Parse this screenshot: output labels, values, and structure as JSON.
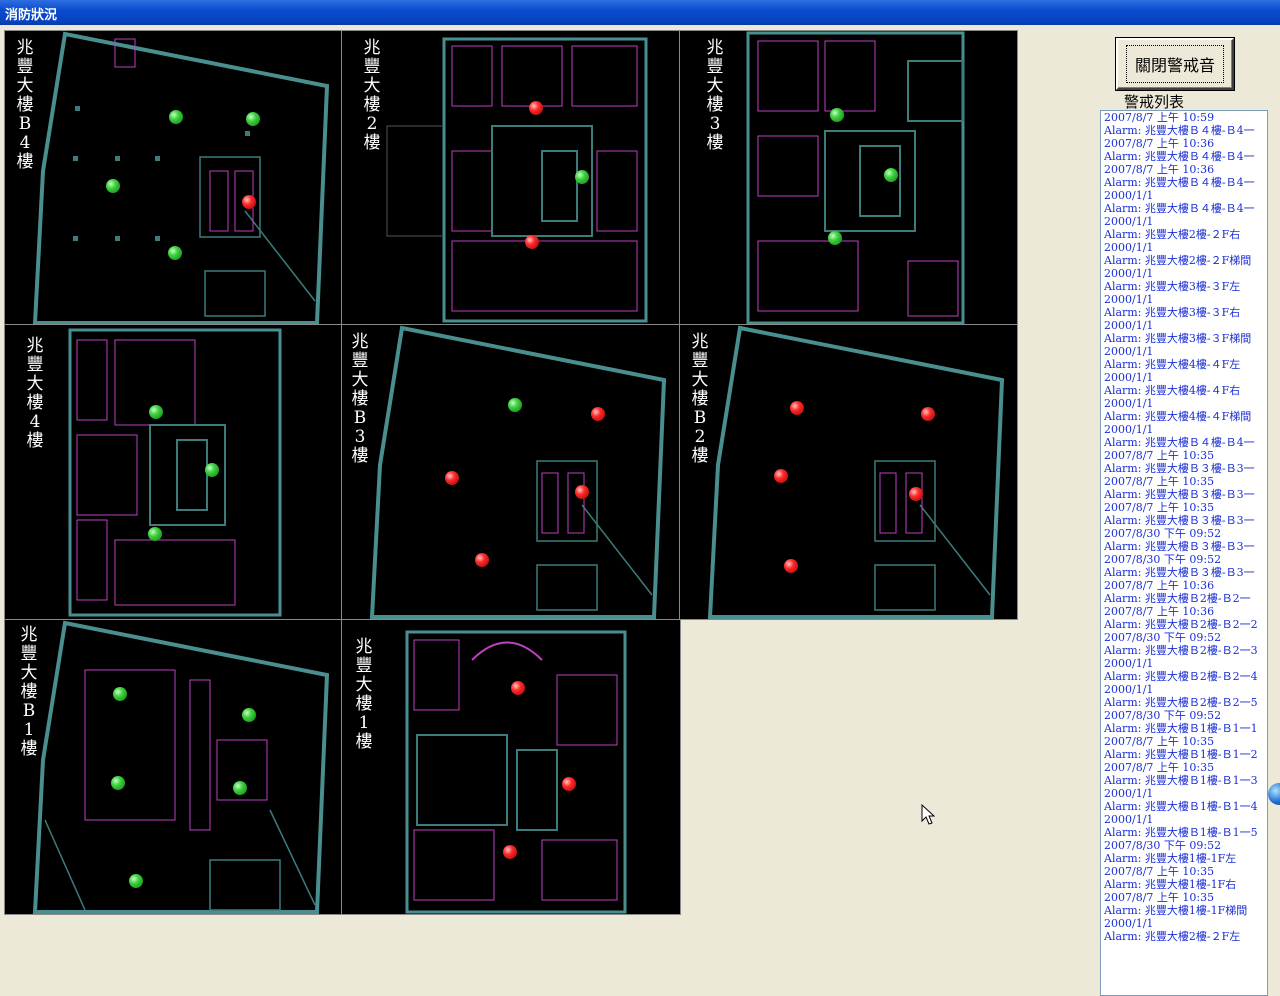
{
  "window": {
    "title": "消防狀況"
  },
  "panels": [
    {
      "label": "兆豐大樓B4樓",
      "dots": [
        "green",
        "green",
        "green",
        "red",
        "green"
      ]
    },
    {
      "label": "兆豐大樓2樓",
      "dots": [
        "red",
        "green",
        "red"
      ]
    },
    {
      "label": "兆豐大樓3樓",
      "dots": [
        "green",
        "green",
        "green"
      ]
    },
    {
      "label": "兆豐大樓4樓",
      "dots": [
        "green",
        "green",
        "green"
      ]
    },
    {
      "label": "兆豐大樓B3樓",
      "dots": [
        "green",
        "red",
        "red",
        "red",
        "red"
      ]
    },
    {
      "label": "兆豐大樓B2樓",
      "dots": [
        "red",
        "red",
        "red",
        "red",
        "red"
      ]
    },
    {
      "label": "兆豐大樓B1樓",
      "dots": [
        "green",
        "green",
        "green",
        "green",
        "green"
      ]
    },
    {
      "label": "兆豐大樓1樓",
      "dots": [
        "red",
        "red",
        "red"
      ]
    }
  ],
  "toolbar": {
    "silence_button": "關閉警戒音"
  },
  "alarm_list": {
    "title": "警戒列表",
    "items": [
      "2007/8/7 上午 10:59",
      "Alarm: 兆豐大樓Ｂ４樓-Ｂ4一",
      "2007/8/7 上午 10:36",
      "Alarm: 兆豐大樓Ｂ４樓-Ｂ4一",
      "2007/8/7 上午 10:36",
      "Alarm: 兆豐大樓Ｂ４樓-Ｂ4一",
      "2000/1/1",
      "Alarm: 兆豐大樓Ｂ４樓-Ｂ4一",
      "2000/1/1",
      "Alarm: 兆豐大樓2樓-２F右",
      "2000/1/1",
      "Alarm: 兆豐大樓2樓-２F梯間",
      "2000/1/1",
      "Alarm: 兆豐大樓3樓-３F左",
      "2000/1/1",
      "Alarm: 兆豐大樓3樓-３F右",
      "2000/1/1",
      "Alarm: 兆豐大樓3樓-３F梯間",
      "2000/1/1",
      "Alarm: 兆豐大樓4樓-４F左",
      "2000/1/1",
      "Alarm: 兆豐大樓4樓-４F右",
      "2000/1/1",
      "Alarm: 兆豐大樓4樓-４F梯間",
      "2000/1/1",
      "Alarm: 兆豐大樓Ｂ４樓-Ｂ4一",
      "2007/8/7 上午 10:35",
      "Alarm: 兆豐大樓Ｂ３樓-Ｂ3一",
      "2007/8/7 上午 10:35",
      "Alarm: 兆豐大樓Ｂ３樓-Ｂ3一",
      "2007/8/7 上午 10:35",
      "Alarm: 兆豐大樓Ｂ３樓-Ｂ3一",
      "2007/8/30 下午 09:52",
      "Alarm: 兆豐大樓Ｂ３樓-Ｂ3一",
      "2007/8/30 下午 09:52",
      "Alarm: 兆豐大樓Ｂ３樓-Ｂ3一",
      "2007/8/7 上午 10:36",
      "Alarm: 兆豐大樓Ｂ2樓-Ｂ2一",
      "2007/8/7 上午 10:36",
      "Alarm: 兆豐大樓Ｂ2樓-Ｂ2一2",
      "2007/8/30 下午 09:52",
      "Alarm: 兆豐大樓Ｂ2樓-Ｂ2一3",
      "2000/1/1",
      "Alarm: 兆豐大樓Ｂ2樓-Ｂ2一4",
      "2000/1/1",
      "Alarm: 兆豐大樓Ｂ2樓-Ｂ2一5",
      "2007/8/30 下午 09:52",
      "Alarm: 兆豐大樓Ｂ1樓-Ｂ1一1",
      "2007/8/7 上午 10:35",
      "Alarm: 兆豐大樓Ｂ1樓-Ｂ1一2",
      "2007/8/7 上午 10:35",
      "Alarm: 兆豐大樓Ｂ1樓-Ｂ1一3",
      "2000/1/1",
      "Alarm: 兆豐大樓Ｂ1樓-Ｂ1一4",
      "2000/1/1",
      "Alarm: 兆豐大樓Ｂ1樓-Ｂ1一5",
      "2007/8/30 下午 09:52",
      "Alarm: 兆豐大樓1樓-1F左",
      "2007/8/7 上午 10:35",
      "Alarm: 兆豐大樓1樓-1F右",
      "2007/8/7 上午 10:35",
      "Alarm: 兆豐大樓1樓-1F梯間",
      "2000/1/1",
      "Alarm: 兆豐大樓2樓-２F左"
    ]
  },
  "colors": {
    "title_bar": "#0a4ccf",
    "alarm_text": "#1a2fd6",
    "status_ok": "#3fd23f",
    "status_alarm": "#ff2b2b",
    "plan_wall": "#4a8f8f"
  },
  "icons": {
    "cursor": "mouse-pointer-icon",
    "globe": "globe-icon"
  }
}
